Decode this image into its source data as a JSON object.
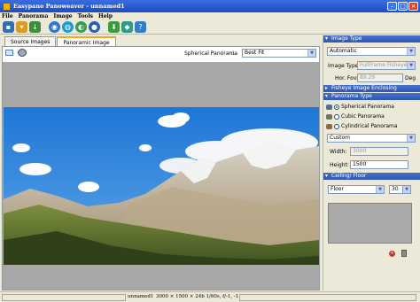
{
  "window": {
    "title": "Easypano Panoweaver - unnamed1"
  },
  "menu": {
    "items": [
      "File",
      "Panorama",
      "Image",
      "Tools",
      "Help"
    ]
  },
  "tabs": {
    "source": "Source Images",
    "panoramic": "Panoramic Image"
  },
  "preview_toolbar": {
    "projection_label": "Spherical Panorama",
    "fit_value": "Best Fit"
  },
  "sidebar": {
    "image_type": {
      "header": "Image Type",
      "type_value": "Automatic",
      "image_type_label": "Image Type:",
      "image_type_value": "FullFrame Fisheye",
      "hor_fov_label": "Hor. Fov:",
      "hor_fov_value": "89.29",
      "hor_fov_unit": "Deg"
    },
    "fisheye": {
      "header": "Fisheye Image Enclosing"
    },
    "panorama_type": {
      "header": "Panorama Type",
      "spherical": "Spherical Panorama",
      "cubic": "Cubic Panorama",
      "cylindrical": "Cylindrical Panorama",
      "size_value": "Custom",
      "width_label": "Width:",
      "width_value": "3000",
      "height_label": "Height:",
      "height_value": "1500"
    },
    "ceiling_floor": {
      "header": "Ceiling/ Floor",
      "floor_value": "Floor",
      "floor_number": "30"
    }
  },
  "status": {
    "filename": "unnamed1",
    "info": "3000 × 1500 × 24b  1/60s, f/-1, -1"
  },
  "colors": {
    "title_bar": "#1d4bc4",
    "section_header": "#2e57b5",
    "accent_tab": "#f7a81f"
  }
}
